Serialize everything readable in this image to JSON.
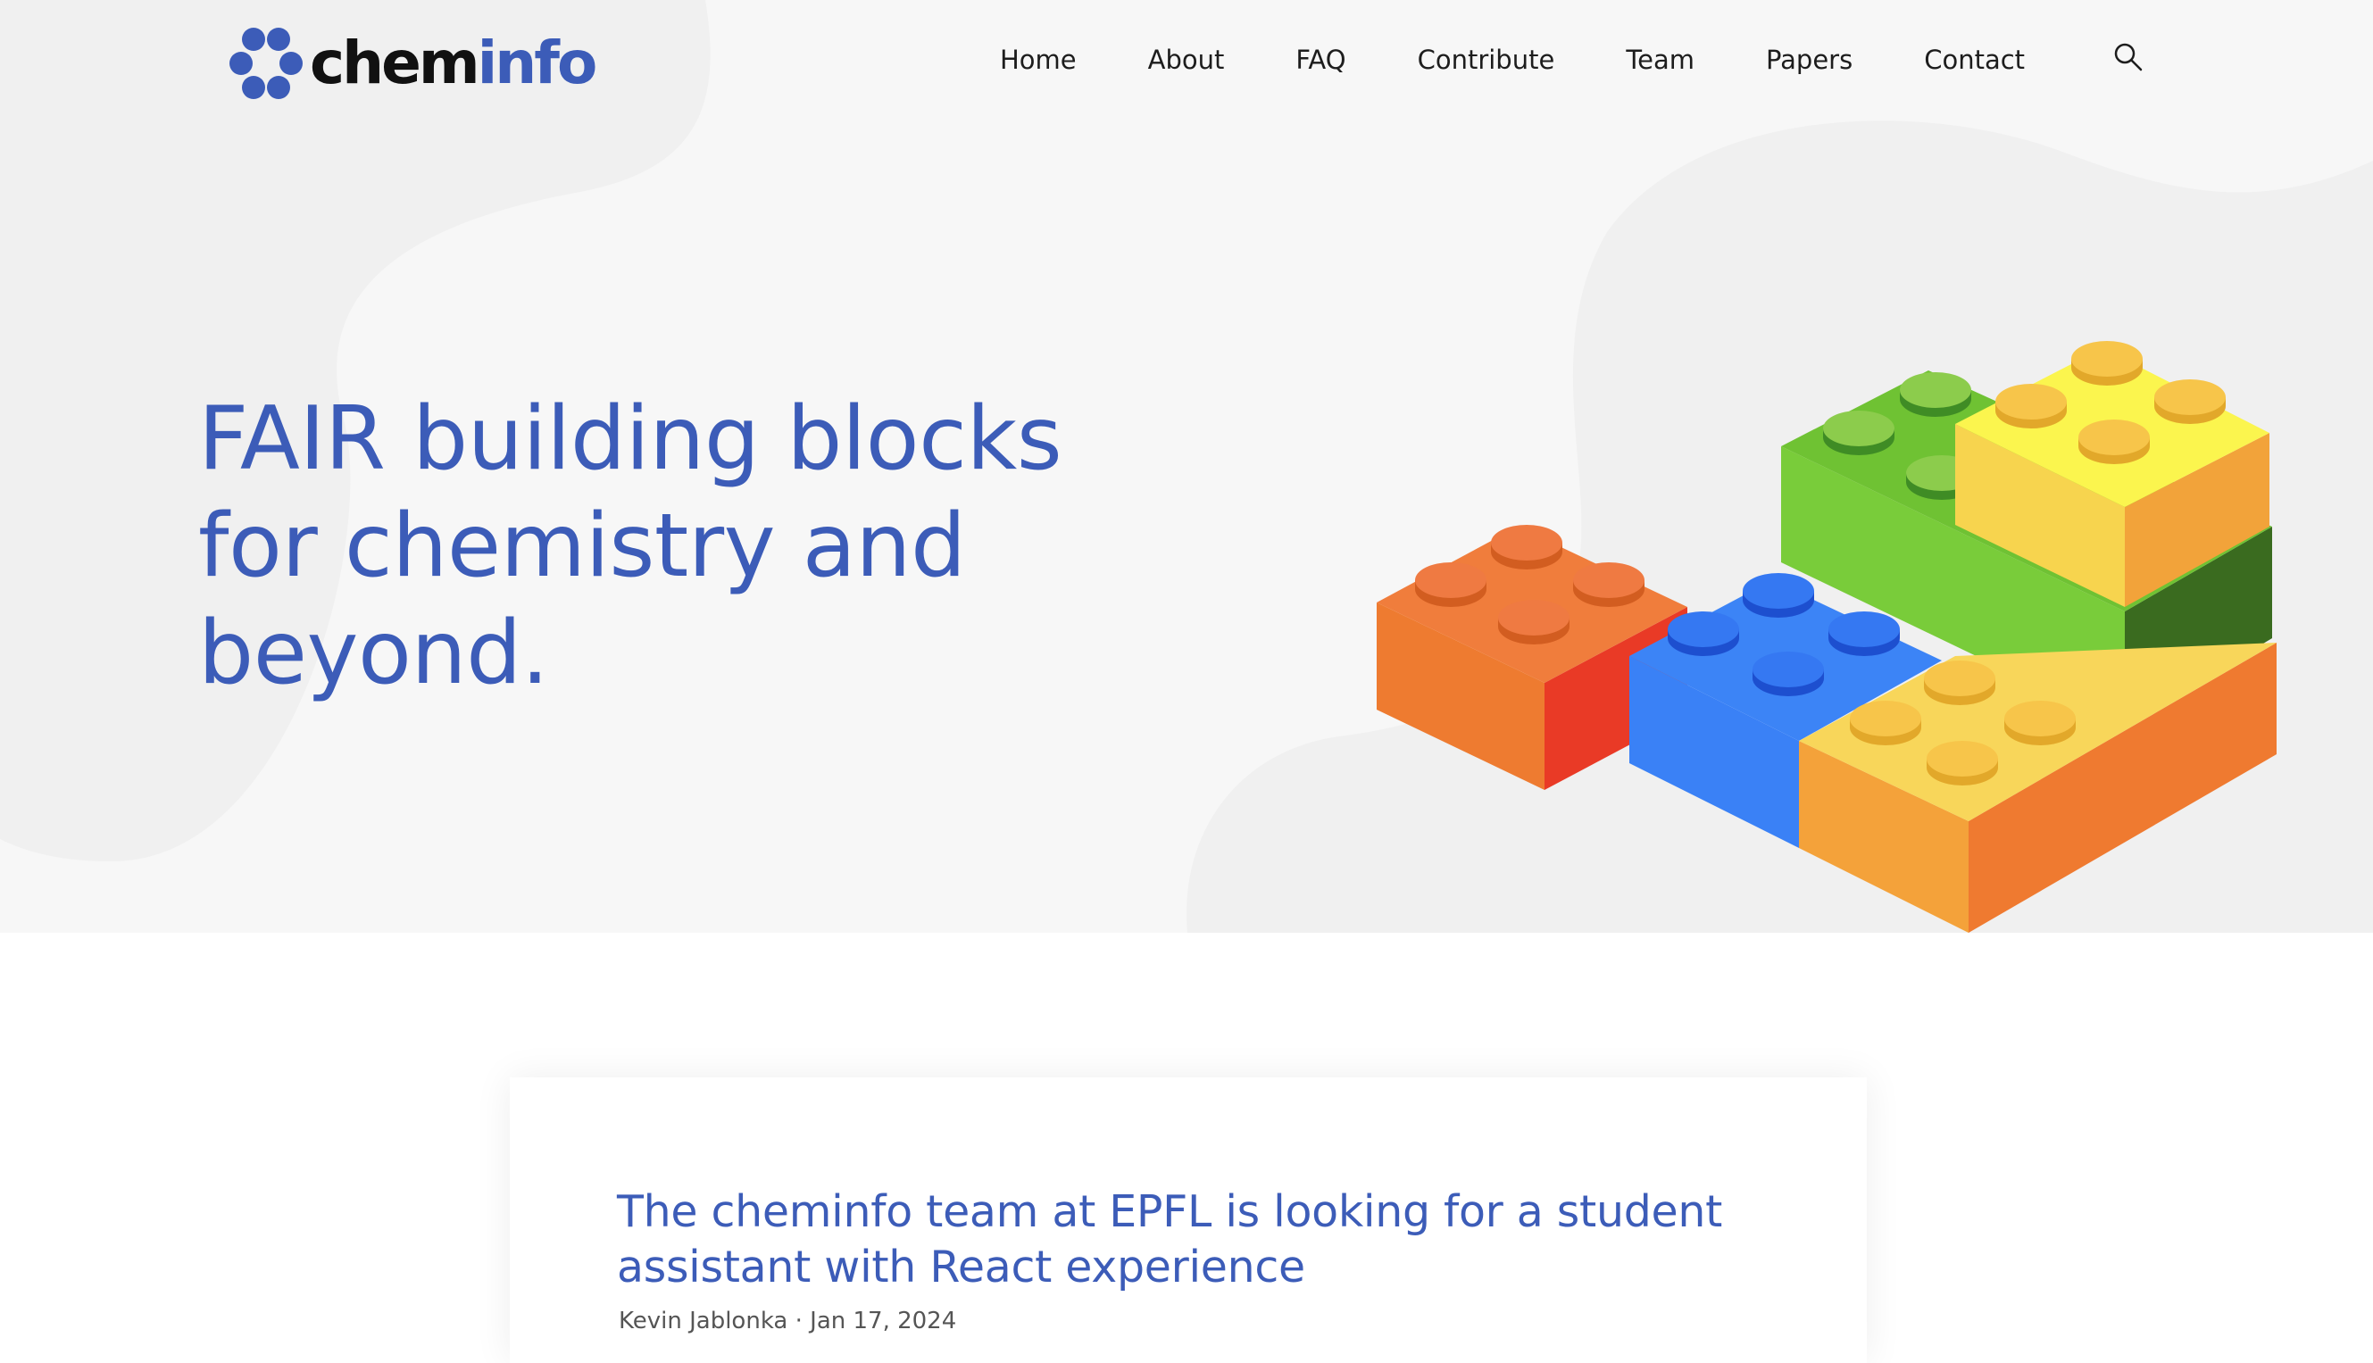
{
  "logo": {
    "text_primary": "chem",
    "text_accent": "info",
    "icon": "cheminfo-flower-logo",
    "colors": {
      "dark": "#111111",
      "accent": "#3c5cb8"
    }
  },
  "nav": {
    "items": [
      "Home",
      "About",
      "FAQ",
      "Contribute",
      "Team",
      "Papers",
      "Contact"
    ],
    "search_icon": "search-icon"
  },
  "hero": {
    "headline": "FAIR building blocks for chemistry and beyond.",
    "illustration": "stacked-lego-bricks",
    "brick_colors": [
      "#ee7b30",
      "#3a81f6",
      "#7acb3c",
      "#f7dc55",
      "#f4a23a"
    ]
  },
  "post": {
    "title": "The cheminfo team at EPFL is looking for a student assistant with React experience",
    "meta": "Kevin Jablonka · Jan 17, 2024"
  }
}
